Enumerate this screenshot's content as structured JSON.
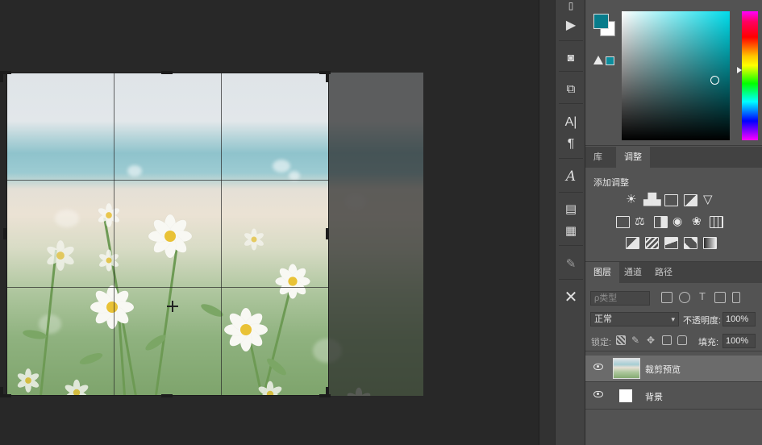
{
  "app": {
    "accent_color": "#087c8b",
    "canvas_bg": "#282828",
    "panel_bg": "#535353"
  },
  "panel_icons": [
    "info-icon",
    "play-icon",
    "swatches-icon",
    "transform-icon",
    "character-icon",
    "paragraph-icon",
    "glyphs-icon",
    "notes-icon",
    "page-icon",
    "brush-settings-icon",
    "tools-icon"
  ],
  "color_panel": {
    "foreground": "#087c8b",
    "background": "#ffffff",
    "gamut_warning_swatch": "#0c8c9c"
  },
  "adjustments": {
    "tabs": [
      "库",
      "调整"
    ],
    "active_tab": "调整",
    "title": "添加调整",
    "icons": [
      "brightness-icon",
      "levels-icon",
      "curves-icon",
      "exposure-icon",
      "vibrance-icon",
      "hue-sat-icon",
      "color-balance-icon",
      "black-white-icon",
      "photo-filter-icon",
      "channel-mixer-icon",
      "color-lookup-icon",
      "invert-icon",
      "posterize-icon",
      "threshold-icon",
      "selective-color-icon",
      "gradient-map-icon"
    ]
  },
  "layers": {
    "tabs": [
      "图层",
      "通道",
      "路径"
    ],
    "active_tab": "图层",
    "search_placeholder": "ρ类型",
    "blend_mode": "正常",
    "opacity_label": "不透明度:",
    "opacity_value": "100%",
    "lock_label": "锁定:",
    "fill_label": "填充:",
    "fill_value": "100%",
    "items": [
      {
        "name": "裁剪预览",
        "selected": true
      },
      {
        "name": "背景",
        "selected": false
      }
    ]
  }
}
